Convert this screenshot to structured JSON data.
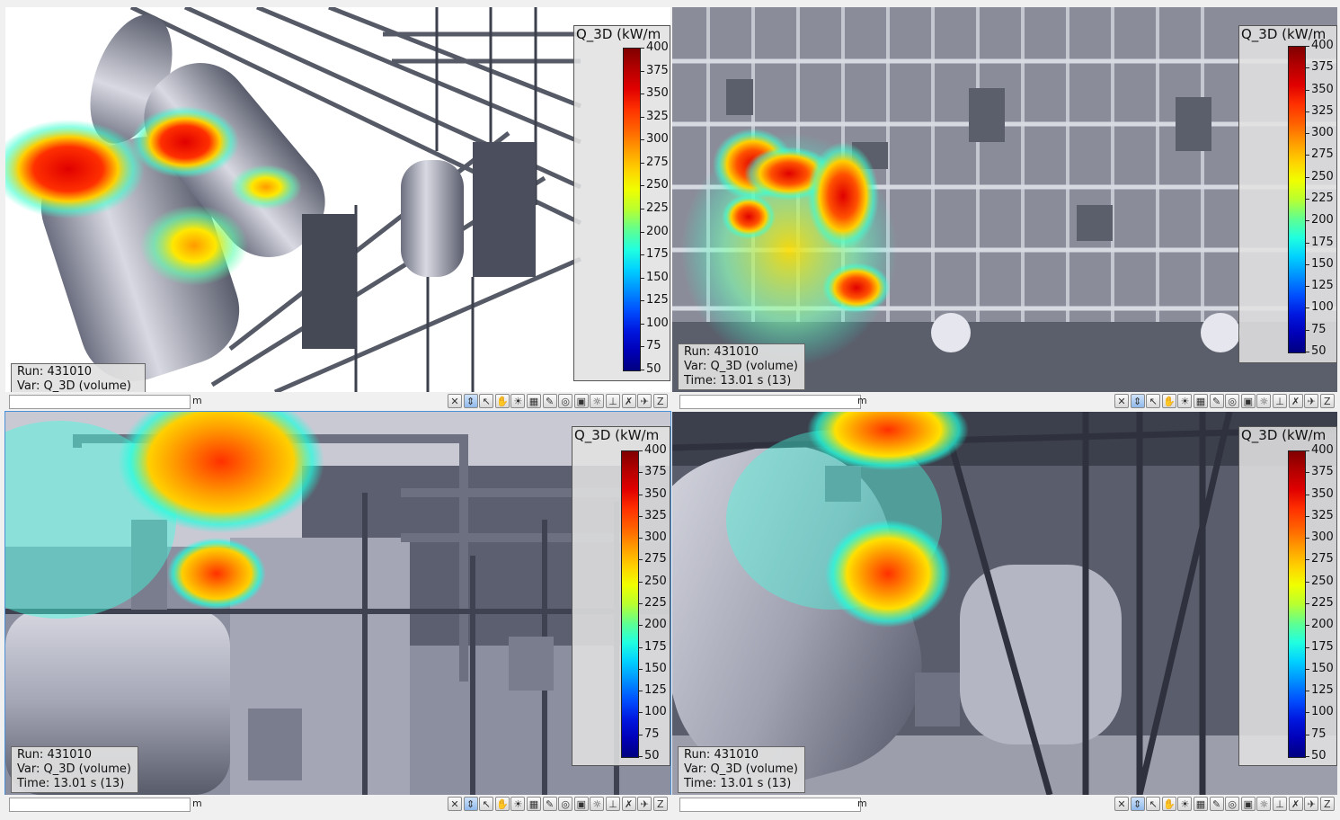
{
  "legend": {
    "title": "Q_3D (kW/m",
    "ticks": [
      "400",
      "375",
      "350",
      "325",
      "300",
      "275",
      "250",
      "225",
      "200",
      "175",
      "150",
      "125",
      "100",
      "75",
      "50"
    ]
  },
  "unit_label": "m",
  "toolbar_icons": [
    "zoom-extent-icon",
    "zoom-region-icon",
    "select-icon",
    "pan-icon",
    "rotate-icon",
    "orbit-icon",
    "pen-icon",
    "measure-icon",
    "camera-icon",
    "light-icon",
    "axis-icon",
    "clear-icon",
    "fly-icon",
    "z-axis-icon"
  ],
  "viewports": [
    {
      "id": "top-left",
      "info": {
        "run": "Run: 431010",
        "var": "Var: Q_3D (volume)",
        "time": ""
      }
    },
    {
      "id": "top-right",
      "info": {
        "run": "Run: 431010",
        "var": "Var: Q_3D (volume)",
        "time": "Time: 13.01 s (13)"
      }
    },
    {
      "id": "bottom-left",
      "info": {
        "run": "Run: 431010",
        "var": "Var: Q_3D (volume)",
        "time": "Time: 13.01 s (13)"
      }
    },
    {
      "id": "bottom-right",
      "info": {
        "run": "Run: 431010",
        "var": "Var: Q_3D (volume)",
        "time": "Time: 13.01 s (13)"
      }
    }
  ],
  "colors": {
    "accent": "#4a90d9",
    "high": "#e00000",
    "mid": "#ffd000",
    "low": "#20ffe0"
  }
}
